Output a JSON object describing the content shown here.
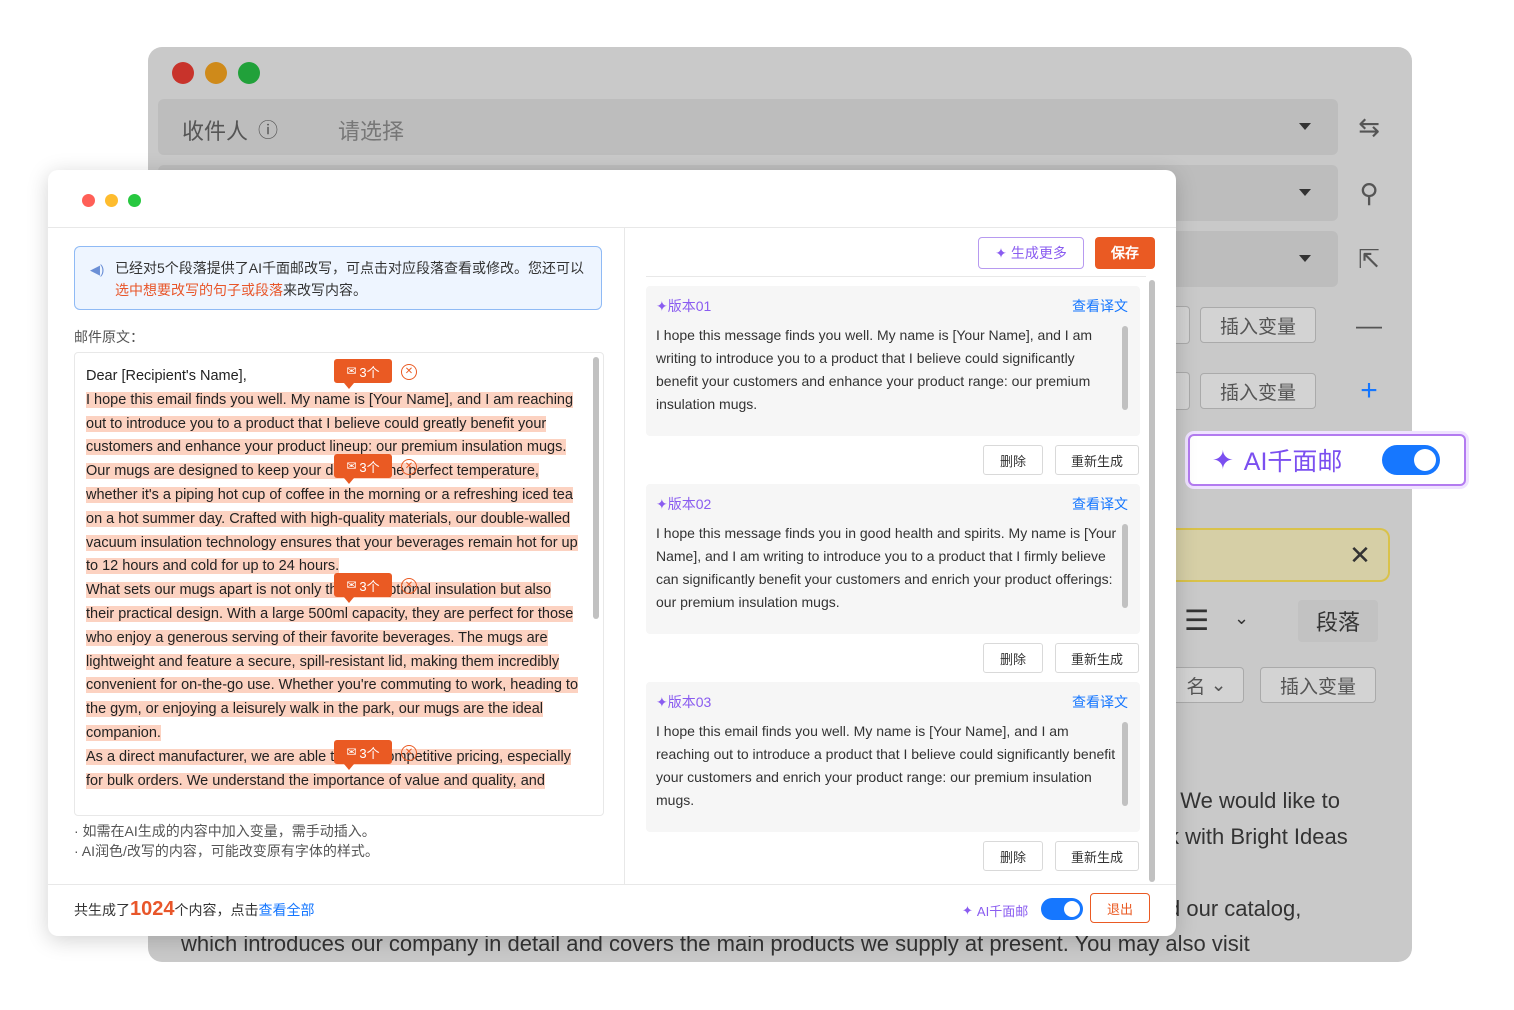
{
  "background_window": {
    "recipient_label": "收件人",
    "recipient_placeholder": "请选择",
    "insert_variable_1": "插入变量",
    "insert_variable_2": "插入变量",
    "insert_variable_3": "插入变量",
    "paragraph_label": "段落",
    "signature_partial": "名",
    "body_line_1": ". We would like to",
    "body_line_2": "k with Bright Ideas",
    "body_line_3": "d our catalog,",
    "body_line_4": "which introduces our company in detail and covers the main products we supply at present. You may also visit"
  },
  "ai_toggle": {
    "label": "AI千面邮",
    "enabled": true
  },
  "dialog": {
    "notice": {
      "text_before": "已经对5个段落提供了AI千面邮改写，可点击对应段落查看或修改。您还可以",
      "highlight": "选中想要改写的句子或段落",
      "text_after": "来改写内容。"
    },
    "original_label": "邮件原文：",
    "original": {
      "greeting": "Dear [Recipient's Name],",
      "paragraphs": [
        "I hope this email finds you well. My name is [Your Name], and I am reaching out to introduce you to a product that I believe could greatly benefit your customers and enhance your product lineup: our premium insulation mugs.",
        "Our mugs are designed to keep your drinks at the perfect temperature, whether it's a piping hot cup of coffee in the morning or a refreshing iced tea on a hot summer day. Crafted with high-quality materials, our double-walled vacuum insulation technology ensures that your beverages remain hot for up to 12 hours and cold for up to 24 hours.",
        "What sets our mugs apart is not only their exceptional insulation but also their practical design. With a large 500ml capacity, they are perfect for those who enjoy a generous serving of their favorite beverages. The mugs are lightweight and feature a secure, spill-resistant lid, making them incredibly convenient for on-the-go use. Whether you're commuting to work, heading to the gym, or enjoying a leisurely walk in the park, our mugs are the ideal companion.",
        "As a direct manufacturer, we are able to offer competitive pricing, especially for bulk orders. We understand the importance of value and quality, and"
      ],
      "badge_label": "3个"
    },
    "notes": [
      "· 如需在AI生成的内容中加入变量，需手动插入。",
      "· AI润色/改写的内容，可能改变原有字体的样式。"
    ],
    "footer": {
      "prefix": "共生成了",
      "count": "1024",
      "middle": "个内容，点击",
      "link": "查看全部",
      "ai_label": "AI千面邮",
      "exit_label": "退出"
    },
    "generate_more_label": "生成更多",
    "save_label": "保存",
    "versions": [
      {
        "title": "版本01",
        "link": "查看译文",
        "text": "I hope this message finds you well. My name is [Your Name], and I am writing to introduce you to a product that I believe could significantly benefit your customers and enhance your product range: our premium insulation mugs.",
        "delete_label": "删除",
        "regenerate_label": "重新生成"
      },
      {
        "title": "版本02",
        "link": "查看译文",
        "text": "I hope this message finds you in good health and spirits. My name is [Your Name], and I am writing to introduce you to a product that I firmly believe can significantly benefit your customers and enrich your product offerings: our premium insulation mugs.",
        "delete_label": "删除",
        "regenerate_label": "重新生成"
      },
      {
        "title": "版本03",
        "link": "查看译文",
        "text": "I hope this email finds you well. My name is [Your Name], and I am reaching out to introduce a product that I believe could significantly benefit your customers and enrich your product range: our premium insulation mugs.",
        "delete_label": "删除",
        "regenerate_label": "重新生成"
      }
    ]
  },
  "colors": {
    "accent_orange": "#ea5a23",
    "accent_purple": "#8a5cf0",
    "link_blue": "#1677ff",
    "highlight_bg": "#fcd2c1"
  }
}
